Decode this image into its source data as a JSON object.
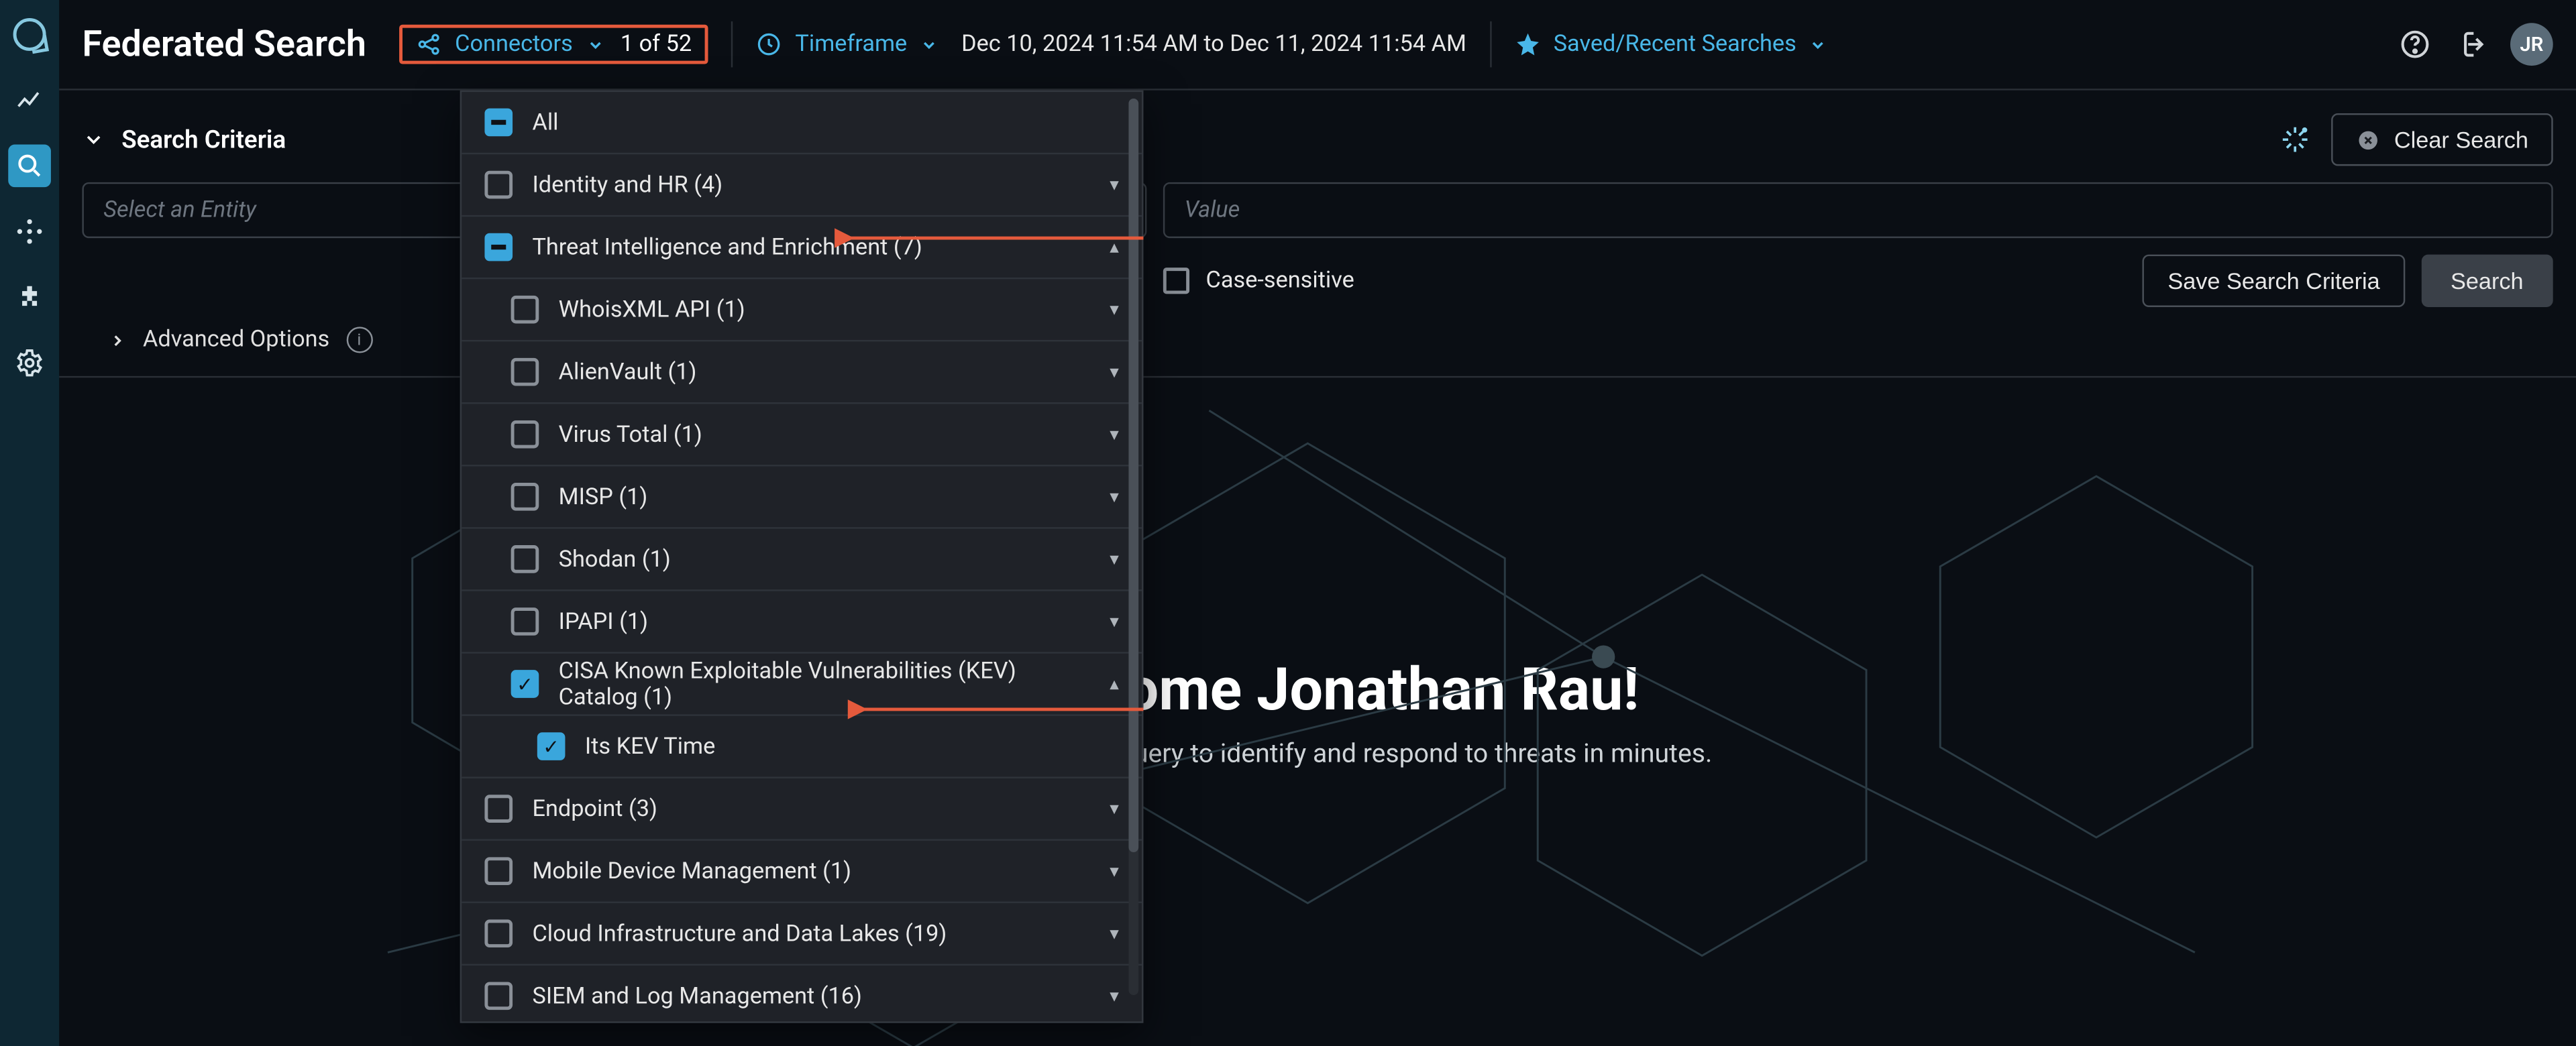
{
  "header": {
    "title": "Federated Search",
    "connectors_label": "Connectors",
    "connectors_count": "1 of 52",
    "timeframe_label": "Timeframe",
    "timeframe_value": "Dec 10, 2024 11:54 AM to Dec 11, 2024 11:54 AM",
    "saved_label": "Saved/Recent Searches",
    "avatar": "JR"
  },
  "criteria": {
    "heading": "Search Criteria",
    "entity_placeholder": "Select an Entity",
    "value_placeholder": "Value",
    "case_sensitive": "Case-sensitive",
    "save_btn": "Save Search Criteria",
    "search_btn": "Search",
    "clear_btn": "Clear Search",
    "advanced": "Advanced Options"
  },
  "hero": {
    "title": "Welcome Jonathan Rau!",
    "subtitle": "Get started with Query to identify and respond to threats in minutes."
  },
  "dropdown": {
    "all": "All",
    "groups": [
      {
        "label": "Identity and HR (4)",
        "state": "unchecked",
        "expanded": false
      },
      {
        "label": "Threat Intelligence and Enrichment (7)",
        "state": "indeterminate",
        "expanded": true,
        "children": [
          {
            "label": "WhoisXML API (1)",
            "state": "unchecked",
            "caret": true
          },
          {
            "label": "AlienVault (1)",
            "state": "unchecked",
            "caret": true
          },
          {
            "label": "Virus Total (1)",
            "state": "unchecked",
            "caret": true
          },
          {
            "label": "MISP (1)",
            "state": "unchecked",
            "caret": true
          },
          {
            "label": "Shodan (1)",
            "state": "unchecked",
            "caret": true
          },
          {
            "label": "IPAPI (1)",
            "state": "unchecked",
            "caret": true
          },
          {
            "label": "CISA Known Exploitable Vulnerabilities (KEV) Catalog (1)",
            "state": "checked",
            "caret": true,
            "expanded": true,
            "children": [
              {
                "label": "Its KEV Time",
                "state": "checked"
              }
            ]
          }
        ]
      },
      {
        "label": "Endpoint (3)",
        "state": "unchecked",
        "expanded": false
      },
      {
        "label": "Mobile Device Management (1)",
        "state": "unchecked",
        "expanded": false
      },
      {
        "label": "Cloud Infrastructure and Data Lakes (19)",
        "state": "unchecked",
        "expanded": false
      },
      {
        "label": "SIEM and Log Management (16)",
        "state": "unchecked",
        "expanded": false
      }
    ]
  }
}
